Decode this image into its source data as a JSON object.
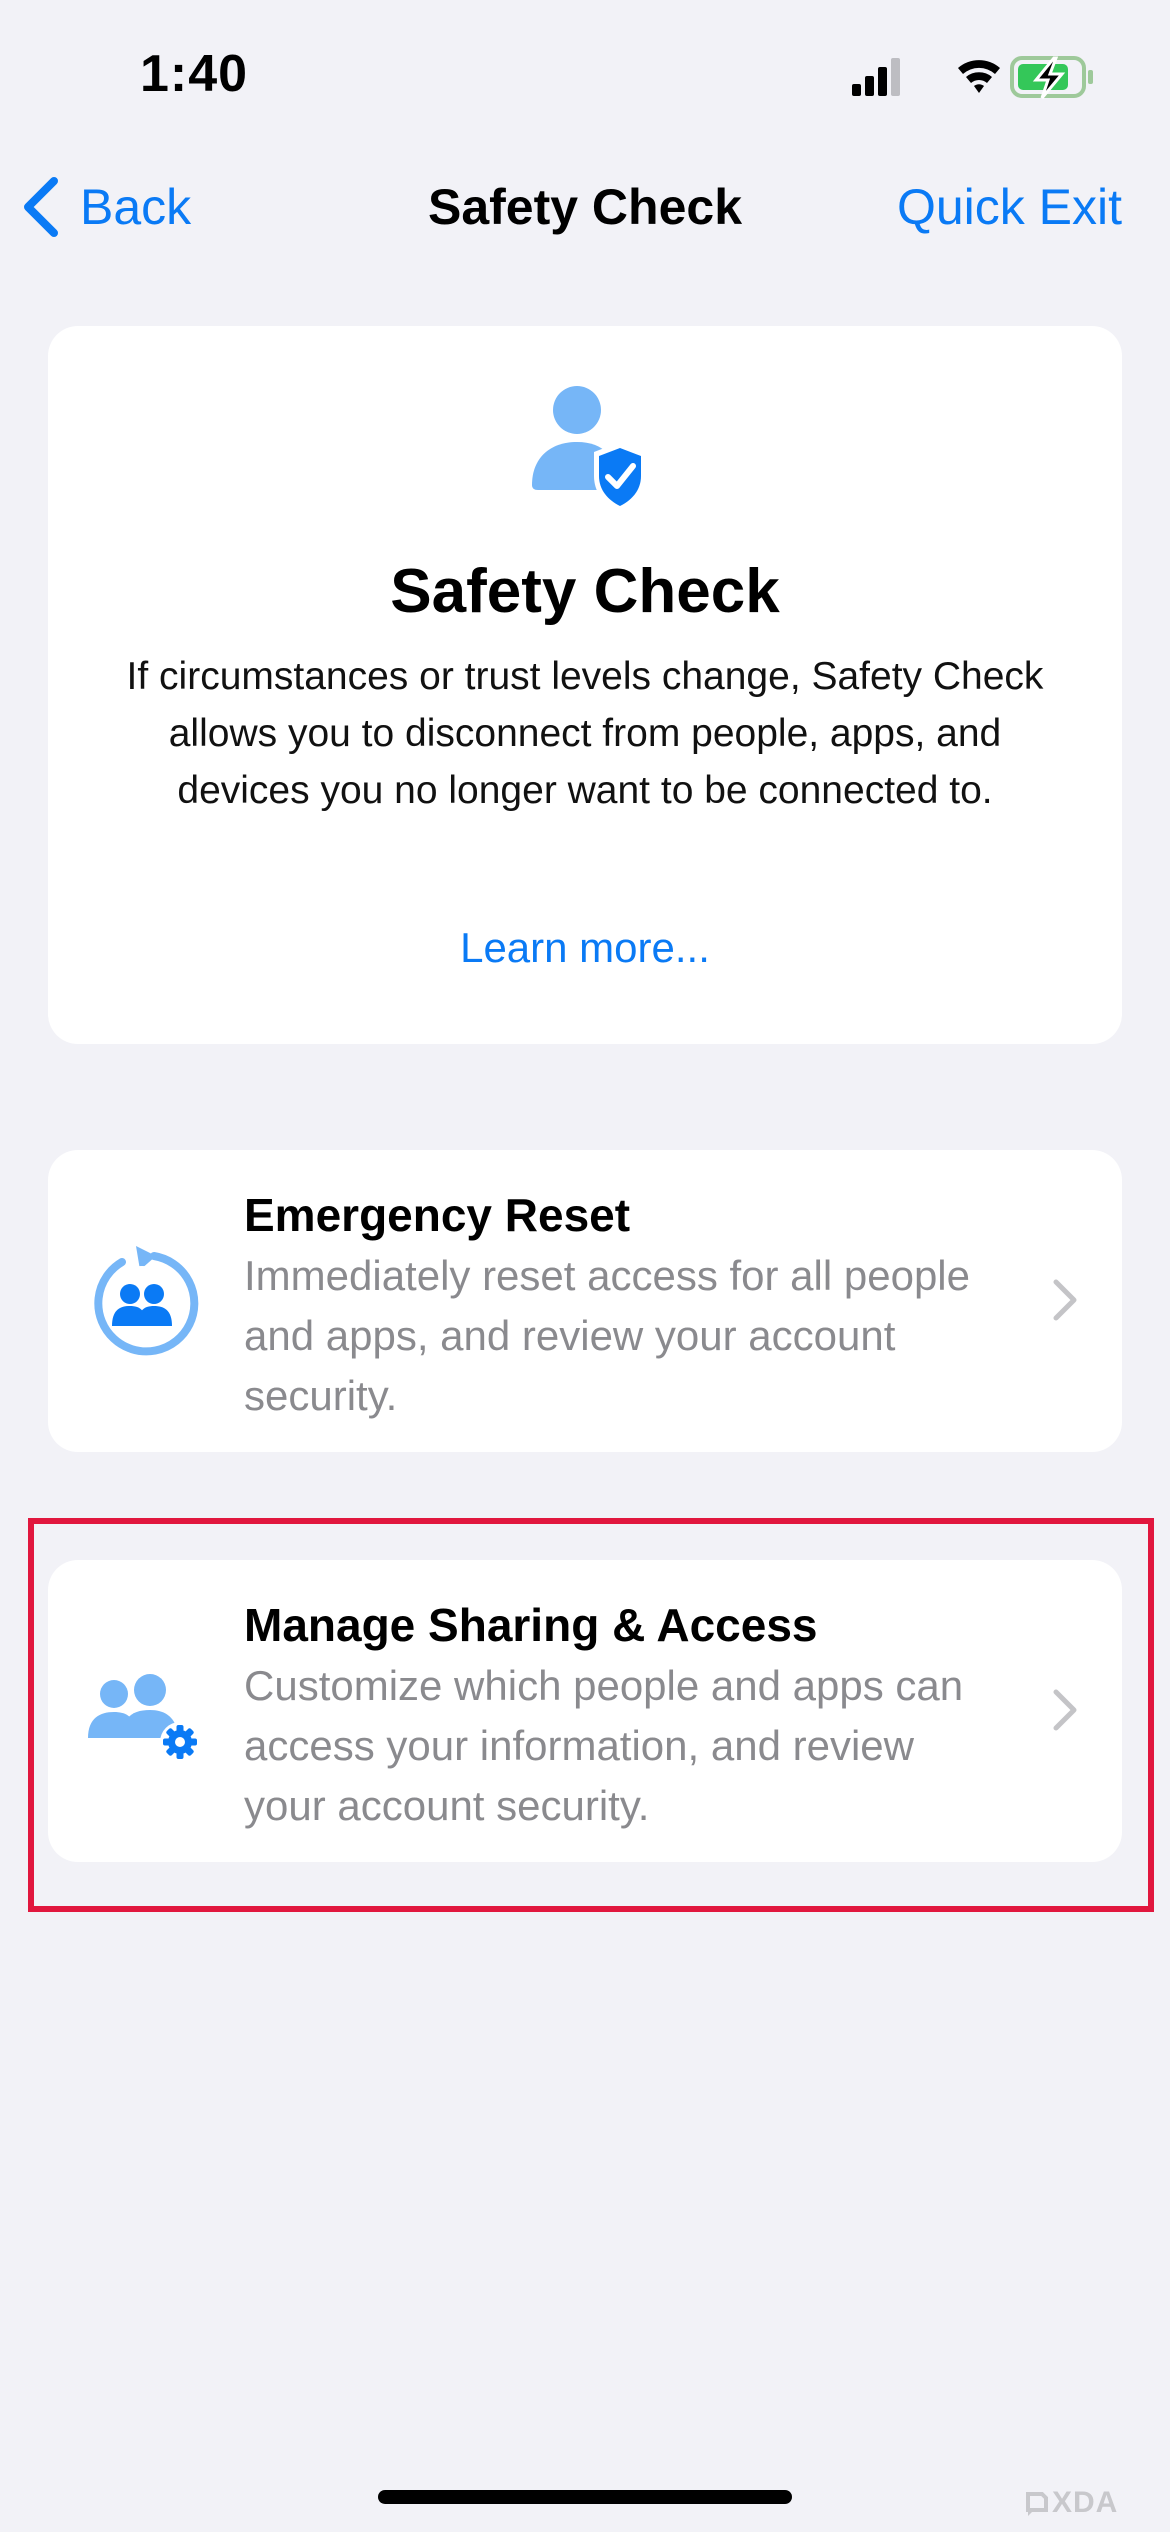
{
  "status_bar": {
    "time": "1:40",
    "icons": [
      "signal-icon",
      "wifi-icon",
      "battery-charging-icon"
    ]
  },
  "nav": {
    "back_label": "Back",
    "title": "Safety Check",
    "quick_exit_label": "Quick Exit"
  },
  "info_card": {
    "icon": "person-shield-check-icon",
    "title": "Safety Check",
    "description": "If circumstances or trust levels change, Safety Check allows you to disconnect from people, apps, and devices you no longer want to be connected to.",
    "learn_more_label": "Learn more..."
  },
  "options": [
    {
      "icon": "emergency-reset-icon",
      "title": "Emergency Reset",
      "description": "Immediately reset access for all people and apps, and review your account security."
    },
    {
      "icon": "people-gear-icon",
      "title": "Manage Sharing & Access",
      "description": "Customize which people and apps can access your information, and review your account security.",
      "highlighted": true
    }
  ],
  "watermark": "XDA",
  "colors": {
    "accent": "#0a7af5",
    "icon_light": "#76b6f7",
    "highlight": "#e1173e",
    "background": "#f2f2f7"
  }
}
